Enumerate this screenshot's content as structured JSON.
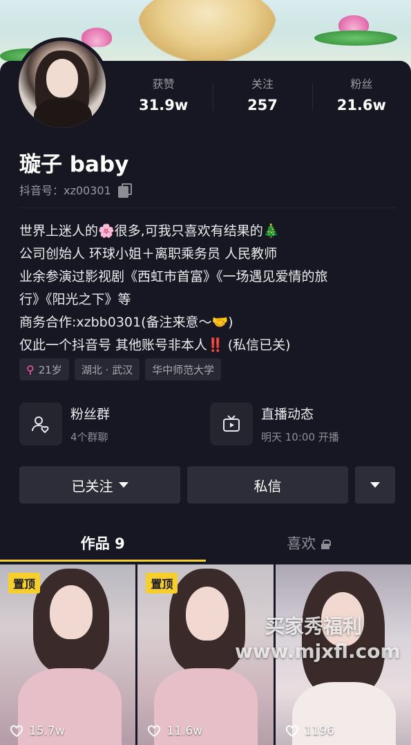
{
  "profile": {
    "name": "璇子 baby",
    "douyin_id": "抖音号：xz00301",
    "stats": [
      {
        "label": "获赞",
        "value": "31.9w"
      },
      {
        "label": "关注",
        "value": "257"
      },
      {
        "label": "粉丝",
        "value": "21.6w"
      }
    ],
    "bio": [
      "世界上迷人的🌸很多,可我只喜欢有结果的🎄",
      "公司创始人 环球小姐＋离职乘务员 人民教师",
      "业余参演过影视剧《西虹市首富》《一场遇见爱情的旅",
      "行》《阳光之下》等",
      "商务合作:xzbb0301(备注来意～🤝)",
      "仅此一个抖音号 其他账号非本人‼️ (私信已关)"
    ],
    "tags": [
      "21岁",
      "湖北 · 武汉",
      "华中师范大学"
    ]
  },
  "features": {
    "fan_group": {
      "title": "粉丝群",
      "sub": "4个群聊",
      "icon": "fan-group-icon"
    },
    "live": {
      "title": "直播动态",
      "sub": "明天 10:00 开播",
      "icon": "live-tv-icon"
    }
  },
  "actions": {
    "follow_label": "已关注",
    "message_label": "私信"
  },
  "tabs": {
    "works": "作品 9",
    "likes": "喜欢"
  },
  "videos": [
    {
      "badge": "置顶",
      "likes": "15.7w"
    },
    {
      "badge": "置顶",
      "likes": "11.6w"
    },
    {
      "badge": "",
      "likes": "1196"
    }
  ],
  "watermark": {
    "line1": "买家秀福利",
    "line2": "www.mjxfl.com"
  },
  "colors": {
    "accent": "#f7cf2c",
    "background": "#161722",
    "female": "#ff5ca8"
  }
}
